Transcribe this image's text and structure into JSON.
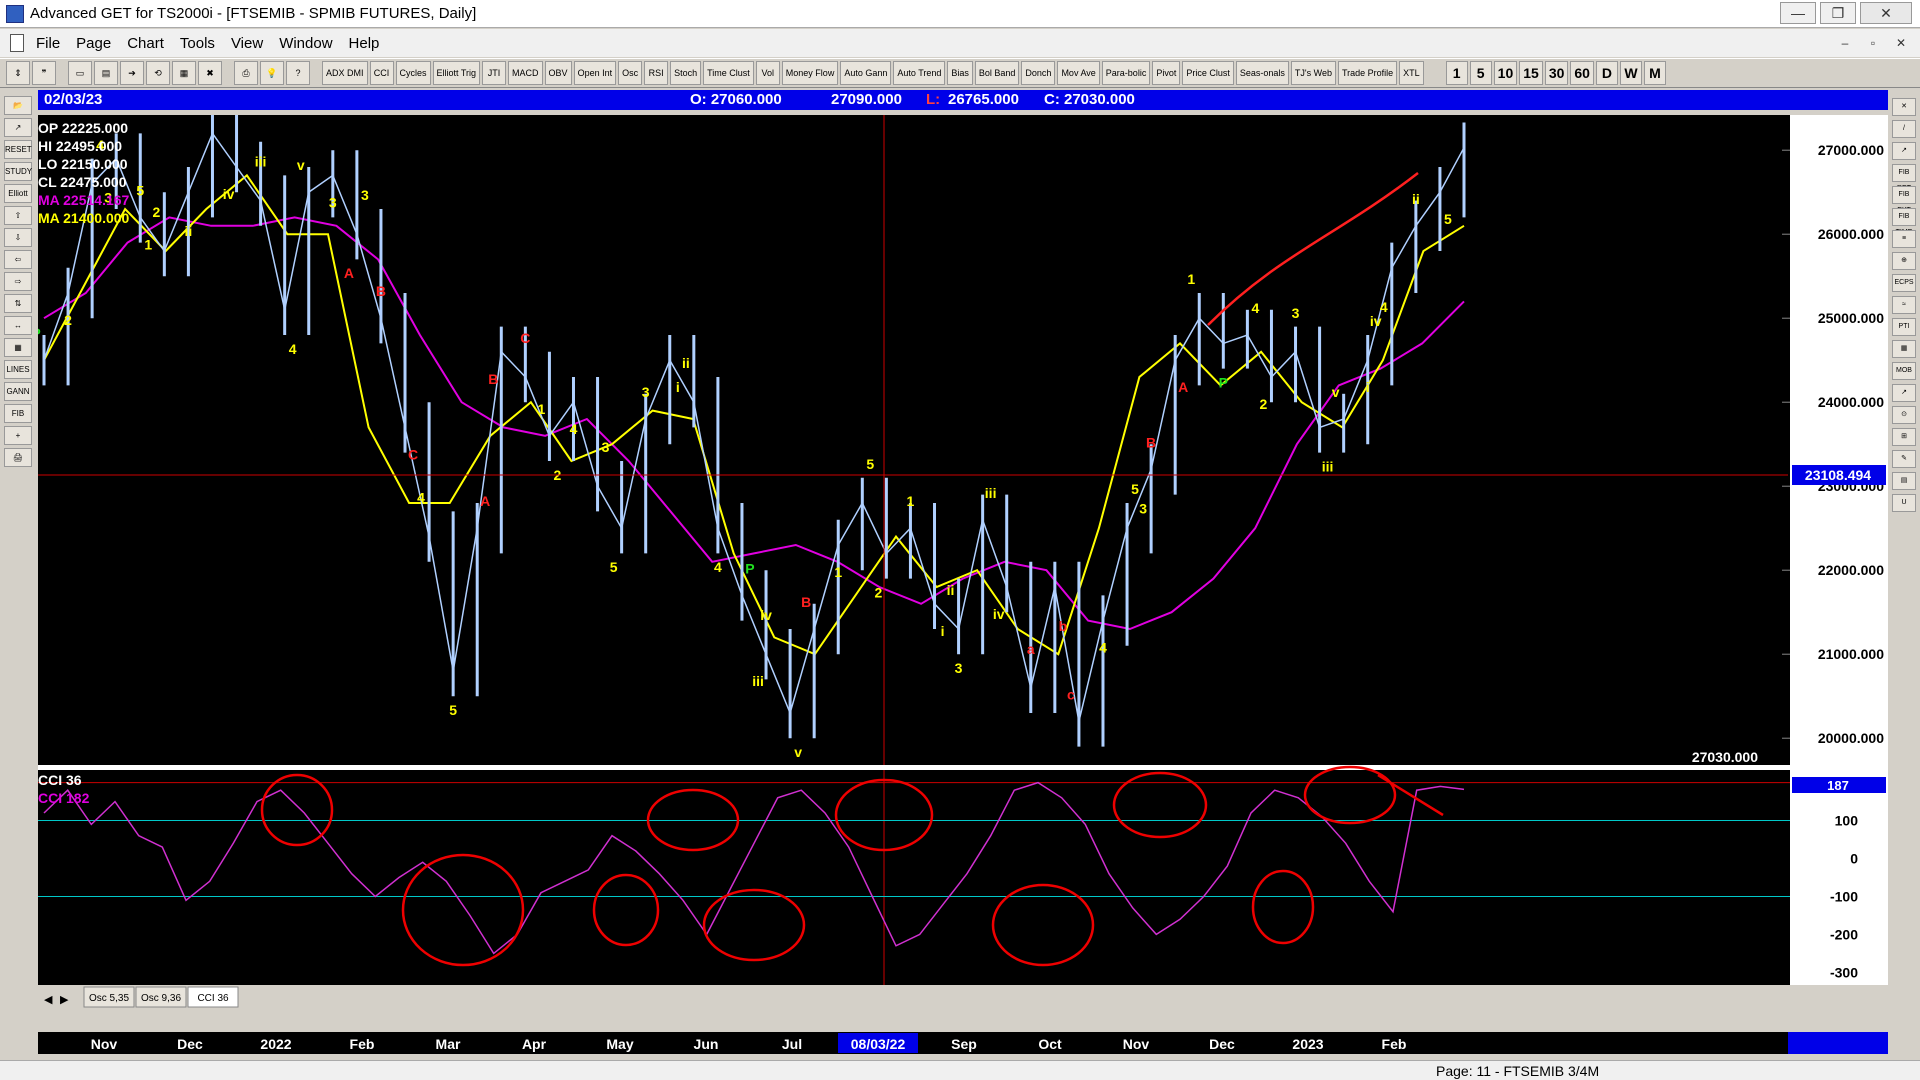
{
  "window": {
    "title": "Advanced GET for TS2000i - [FTSEMIB - SPMIB FUTURES, Daily]",
    "buttons": [
      "—",
      "❐",
      "✕"
    ]
  },
  "menu": {
    "items": [
      "File",
      "Page",
      "Chart",
      "Tools",
      "View",
      "Window",
      "Help"
    ],
    "mdi_buttons": [
      "–",
      "▫",
      "✕"
    ]
  },
  "toolbar": {
    "study_buttons": [
      "ADX DMI",
      "CCI",
      "Cycles",
      "Elliott Trig",
      "JTI",
      "MACD",
      "OBV",
      "Open Int",
      "Osc",
      "RSI",
      "Stoch",
      "Time Clust",
      "Vol",
      "Money Flow",
      "Auto Gann",
      "Auto Trend",
      "Bias",
      "Bol Band",
      "Donch",
      "Mov Ave",
      "Para-bolic",
      "Pivot",
      "Price Clust",
      "Seas-onals",
      "TJ's Web",
      "Trade Profile",
      "XTL"
    ],
    "period_buttons": [
      "1",
      "5",
      "10",
      "15",
      "30",
      "60",
      "D",
      "W",
      "M"
    ]
  },
  "left_tools": [
    "📂",
    "↗",
    "RESET",
    "STUDY",
    "Elliott",
    "⇧",
    "⇩",
    "⇦",
    "⇨",
    "⇅",
    "↔",
    "▦",
    "LINES",
    "GANN",
    "FIB",
    "+",
    "🖨"
  ],
  "right_tools": [
    "✕",
    "/",
    "↗",
    "FIB RET",
    "FIB EXT",
    "FIB TIME",
    "≡",
    "⊕",
    "ECPS",
    "≈",
    "PTI",
    "▦",
    "MOB",
    "↗",
    "⊙",
    "⊞",
    "✎",
    "▤",
    "U"
  ],
  "header": {
    "date": "02/03/23",
    "open": "O: 27060.000",
    "high": "27090.000",
    "low_label": "L:",
    "low": "26765.000",
    "close": "C: 27030.000"
  },
  "overlay": {
    "op": "OP  22225.000",
    "hi": "HI   22495.000",
    "lo": "LO  22150.000",
    "cl": "CL  22475.000",
    "ma1": "MA  22514.167",
    "ma2": "MA  21400.000"
  },
  "colors": {
    "price": "#b0d0ff",
    "ma_yellow": "#ffff00",
    "ma_magenta": "#e000e0",
    "wave_label": "#ffff00",
    "abc_label": "#ff2020",
    "pivot": "#20e020",
    "annotation_red": "#ff0000",
    "cci": "#d030d0",
    "cursor_line": "#cc0000",
    "info_bar": "#0000e8"
  },
  "chart_data": {
    "type": "line",
    "y_axis": {
      "ylim": [
        19800,
        27300
      ],
      "ticks": [
        "20000.000",
        "21000.000",
        "22000.000",
        "23000.000",
        "24000.000",
        "25000.000",
        "26000.000",
        "27000.000"
      ]
    },
    "cursor_price": "23108.494",
    "last_price": "27030.000",
    "x_labels": [
      "Nov",
      "Dec",
      "2022",
      "Feb",
      "Mar",
      "Apr",
      "May",
      "Jun",
      "Jul",
      "08/03/22",
      "Sep",
      "Oct",
      "Nov",
      "Dec",
      "2023",
      "Feb"
    ],
    "price_series": [
      24500,
      25300,
      26600,
      26900,
      26200,
      25800,
      26500,
      27200,
      26800,
      26400,
      25100,
      26500,
      26700,
      26000,
      25000,
      23700,
      22400,
      20800,
      22500,
      24600,
      24300,
      23600,
      24000,
      23000,
      22500,
      23800,
      24500,
      24000,
      22500,
      21700,
      21000,
      20300,
      21300,
      22300,
      22800,
      22200,
      22500,
      21600,
      21300,
      22600,
      21800,
      20600,
      21800,
      20200,
      21400,
      22500,
      23200,
      24500,
      25000,
      24700,
      24800,
      24300,
      24600,
      23700,
      23800,
      24500,
      25600,
      26100,
      26500,
      27030
    ],
    "ma_yellow_series": [
      24500,
      25400,
      26300,
      25800,
      26300,
      26700,
      26000,
      26000,
      23700,
      22800,
      22800,
      23600,
      24000,
      23300,
      23500,
      23900,
      23800,
      22200,
      21200,
      21000,
      21700,
      22400,
      21800,
      22000,
      21300,
      21000,
      22500,
      24300,
      24700,
      24200,
      24600,
      24000,
      23700,
      24500,
      25800,
      26100
    ],
    "ma_magenta_series": [
      25000,
      25300,
      25900,
      26200,
      26100,
      26100,
      26200,
      26100,
      25700,
      24800,
      24000,
      23700,
      23600,
      23800,
      23300,
      22700,
      22100,
      22200,
      22300,
      22100,
      21800,
      21600,
      21900,
      22100,
      22000,
      21400,
      21300,
      21500,
      21900,
      22500,
      23500,
      24200,
      24400,
      24700,
      25200
    ],
    "wave_labels": [
      "P",
      "2",
      "4",
      "3",
      "5",
      "1",
      "2",
      "ii",
      "i",
      "iv",
      "iii",
      "4",
      "v",
      "3",
      "3",
      "A",
      "B",
      "C",
      "4",
      "5",
      "A",
      "B",
      "C",
      "2",
      "1",
      "4",
      "3",
      "5",
      "3",
      "i",
      "ii",
      "4",
      "P",
      "iii",
      "iv",
      "v",
      "B",
      "1",
      "5",
      "2",
      "1",
      "i",
      "ii",
      "3",
      "iii",
      "iv",
      "a",
      "b",
      "c",
      "4",
      "5",
      "3",
      "B",
      "A",
      "1",
      "P",
      "4",
      "2",
      "3",
      "iii",
      "v",
      "i",
      "iv",
      "4",
      "ii",
      "5",
      "v"
    ],
    "cci": {
      "title": "CCI 36",
      "value_label": "CCI  182",
      "current": "187",
      "ylim": [
        -320,
        220
      ],
      "ticks": [
        "100",
        "0",
        "-100",
        "-200",
        "-300"
      ],
      "series": [
        120,
        180,
        90,
        150,
        60,
        30,
        -110,
        -60,
        40,
        150,
        180,
        120,
        40,
        -40,
        -100,
        -50,
        -10,
        -60,
        -150,
        -250,
        -200,
        -90,
        -60,
        -30,
        60,
        20,
        -40,
        -110,
        -200,
        -80,
        40,
        160,
        180,
        120,
        30,
        -100,
        -230,
        -200,
        -120,
        -40,
        60,
        180,
        200,
        160,
        90,
        -40,
        -130,
        -200,
        -160,
        -100,
        -20,
        120,
        180,
        160,
        110,
        40,
        -60,
        -140,
        180,
        190,
        182
      ]
    }
  },
  "bottom_tabs": {
    "nav": [
      "◀",
      "▶"
    ],
    "tabs": [
      "Osc 5,35",
      "Osc 9,36",
      "CCI 36"
    ]
  },
  "status": {
    "page": "Page: 11 - FTSEMIB 3/4M"
  }
}
